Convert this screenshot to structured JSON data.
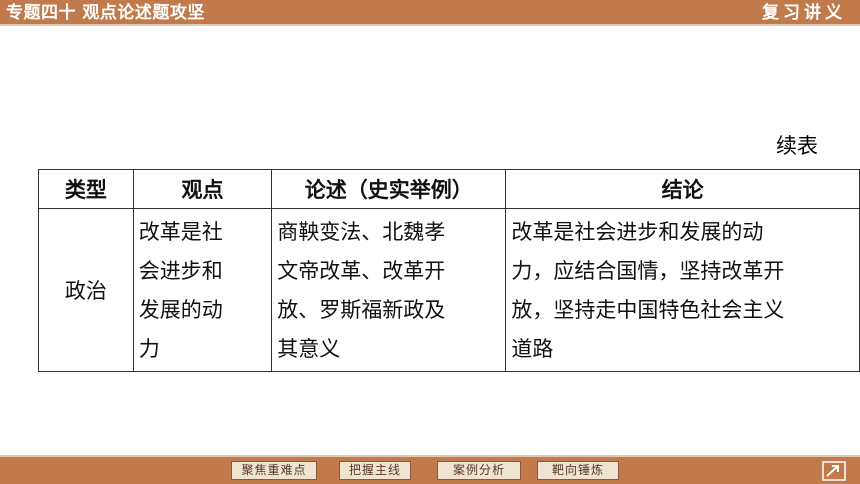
{
  "header": {
    "title": "专题四十 观点论述题攻坚",
    "subtitle": "复习讲义"
  },
  "continued_label": "续表",
  "table": {
    "headers": [
      "类型",
      "观点",
      "论述（史实举例）",
      "结论"
    ],
    "rows": [
      {
        "type": "政治",
        "viewpoint": [
          "改革是社",
          "会进步和",
          "发展的动",
          "力"
        ],
        "argument": [
          "商鞅变法、北魏孝",
          "文帝改革、改革开",
          "放、罗斯福新政及",
          "其意义"
        ],
        "conclusion": [
          "改革是社会进步和发展的动",
          "力，应结合国情，坚持改革开",
          "放，坚持走中国特色社会主义",
          "道路"
        ]
      }
    ]
  },
  "footer": {
    "nav": [
      "聚焦重难点",
      "把握主线",
      "案例分析",
      "靶向锤炼"
    ]
  },
  "colors": {
    "bar": "#c07a4c",
    "bar_highlight": "#e7c9b2",
    "button_bg": "#efe3d2"
  }
}
